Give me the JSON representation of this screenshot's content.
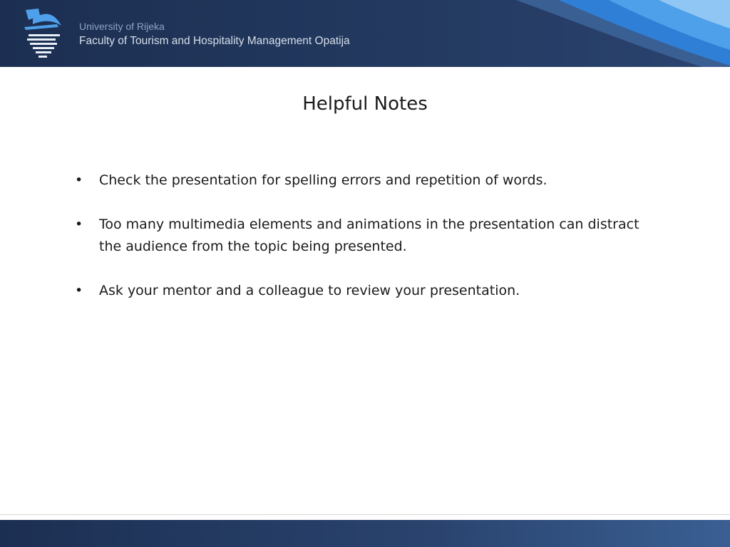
{
  "header": {
    "university": "University of Rijeka",
    "faculty": "Faculty of Tourism and Hospitality Management Opatija",
    "logo_icon": "university-logo-icon"
  },
  "slide": {
    "title": "Helpful Notes",
    "bullet_symbol": "•",
    "bullets": [
      "Check the presentation for spelling errors and repetition of words.",
      "Too many multimedia elements and animations in the presentation can distract the audience from the topic being presented.",
      "Ask your mentor and a colleague to review your presentation."
    ]
  },
  "colors": {
    "header_bg": "#1c2f52",
    "accent_blue": "#2f7fd6",
    "text": "#1a1a1a"
  }
}
